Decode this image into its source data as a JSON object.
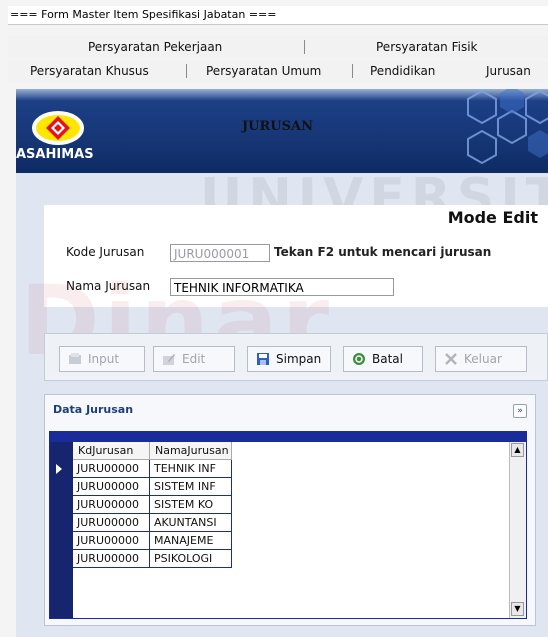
{
  "window": {
    "title": "=== Form Master Item Spesifikasi Jabatan ==="
  },
  "tabs": {
    "row1": [
      "Persyaratan Pekerjaan",
      "Persyaratan Fisik"
    ],
    "row2": [
      "Persyaratan Khusus",
      "Persyaratan Umum",
      "Pendidikan",
      "Jurusan"
    ]
  },
  "banner": {
    "heading": "JURUSAN",
    "brand": "ASAHIMAS"
  },
  "watermark": {
    "top": "UNIVERSIT",
    "bottom": "Dinar"
  },
  "form": {
    "mode": "Mode Edit",
    "kode_label": "Kode Jurusan",
    "kode_value": "JURU000001",
    "hint": "Tekan F2 untuk mencari jurusan",
    "nama_label": "Nama Jurusan",
    "nama_value": "TEHNIK INFORMATIKA"
  },
  "toolbar": {
    "input": "Input",
    "edit": "Edit",
    "simpan": "Simpan",
    "batal": "Batal",
    "keluar": "Keluar"
  },
  "datapanel": {
    "title": "Data Jurusan",
    "columns": [
      "KdJurusan",
      "NamaJurusan"
    ],
    "rows": [
      [
        "JURU00000",
        "TEHNIK INF"
      ],
      [
        "JURU00000",
        "SISTEM INF"
      ],
      [
        "JURU00000",
        "SISTEM KO"
      ],
      [
        "JURU00000",
        "AKUNTANSI"
      ],
      [
        "JURU00000",
        "MANAJEME"
      ],
      [
        "JURU00000",
        "PSIKOLOGI"
      ]
    ]
  },
  "colors": {
    "banner": "#163675",
    "accent": "#1f3d7a",
    "grid": "#1a2b9a"
  }
}
